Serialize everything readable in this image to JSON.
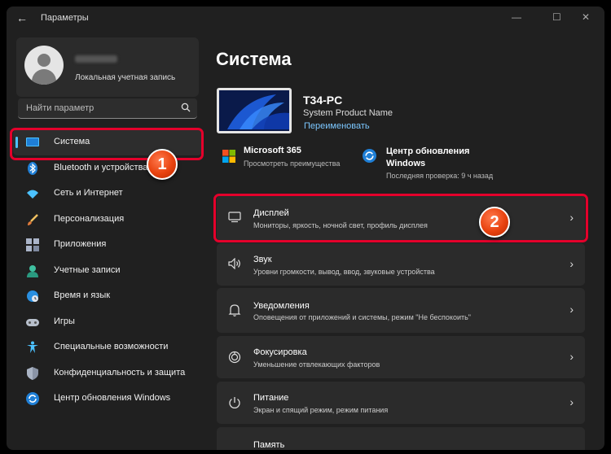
{
  "window": {
    "title": "Параметры",
    "back_icon": "←",
    "minimize": "—",
    "maximize": "☐",
    "close": "✕"
  },
  "profile": {
    "account_type": "Локальная учетная запись"
  },
  "search": {
    "placeholder": "Найти параметр"
  },
  "sidebar": {
    "items": [
      {
        "label": "Система",
        "icon": "monitor-icon"
      },
      {
        "label": "Bluetooth и устройства",
        "icon": "bluetooth-icon"
      },
      {
        "label": "Сеть и Интернет",
        "icon": "wifi-icon"
      },
      {
        "label": "Персонализация",
        "icon": "brush-icon"
      },
      {
        "label": "Приложения",
        "icon": "apps-icon"
      },
      {
        "label": "Учетные записи",
        "icon": "account-icon"
      },
      {
        "label": "Время и язык",
        "icon": "globe-clock-icon"
      },
      {
        "label": "Игры",
        "icon": "gamepad-icon"
      },
      {
        "label": "Специальные возможности",
        "icon": "accessibility-icon"
      },
      {
        "label": "Конфиденциальность и защита",
        "icon": "shield-icon"
      },
      {
        "label": "Центр обновления Windows",
        "icon": "update-icon"
      }
    ]
  },
  "main": {
    "heading": "Система",
    "device": {
      "name": "T34-PC",
      "model": "System Product Name",
      "rename_link": "Переименовать"
    },
    "ms365": {
      "title": "Microsoft 365",
      "subtitle": "Просмотреть преимущества"
    },
    "windows_update": {
      "title": "Центр обновления Windows",
      "subtitle": "Последняя проверка: 9 ч назад"
    },
    "cards": [
      {
        "title": "Дисплей",
        "subtitle": "Мониторы, яркость, ночной свет, профиль дисплея",
        "icon": "display-icon"
      },
      {
        "title": "Звук",
        "subtitle": "Уровни громкости, вывод, ввод, звуковые устройства",
        "icon": "speaker-icon"
      },
      {
        "title": "Уведомления",
        "subtitle": "Оповещения от приложений и системы, режим \"Не беспокоить\"",
        "icon": "bell-icon"
      },
      {
        "title": "Фокусировка",
        "subtitle": "Уменьшение отвлекающих факторов",
        "icon": "focus-icon"
      },
      {
        "title": "Питание",
        "subtitle": "Экран и спящий режим, режим питания",
        "icon": "power-icon"
      }
    ],
    "partial_card_title": "Память"
  },
  "annotations": {
    "badge1": "1",
    "badge2": "2",
    "highlight_color": "#e4002b"
  },
  "colors": {
    "accent": "#4cc2ff",
    "background": "#202020",
    "card": "#2b2b2b"
  }
}
